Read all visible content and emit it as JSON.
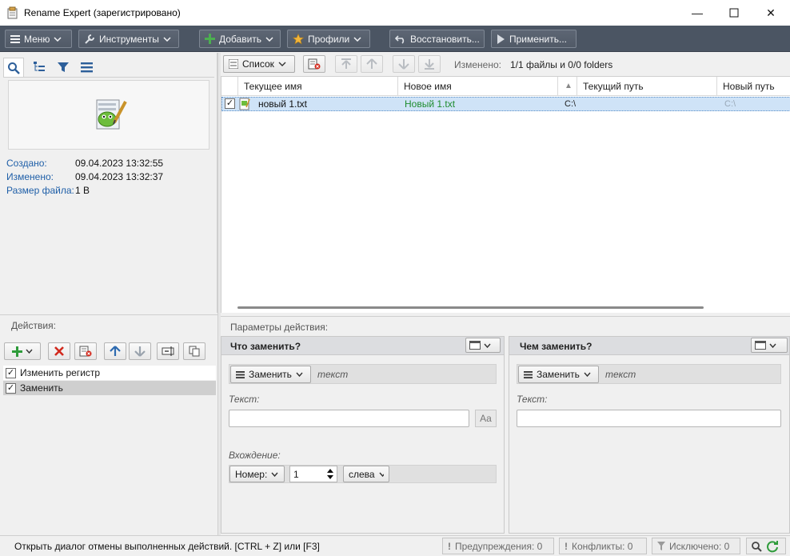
{
  "window": {
    "title": "Rename Expert (зарегистрировано)",
    "min_glyph": "—",
    "max_glyph": "☐",
    "close_glyph": "✕"
  },
  "toolbar": {
    "menu": "Меню",
    "tools": "Инструменты",
    "add": "Добавить",
    "profiles": "Профили",
    "restore": "Восстановить...",
    "apply": "Применить..."
  },
  "info": {
    "created_label": "Создано:",
    "created_value": "09.04.2023 13:32:55",
    "modified_label": "Изменено:",
    "modified_value": "09.04.2023 13:32:37",
    "size_label": "Размер файла:",
    "size_value": "1 B"
  },
  "grid_toolbar": {
    "view_label": "Список",
    "changed_label": "Изменено:",
    "changed_value": "1/1 файлы и 0/0 folders"
  },
  "grid": {
    "columns": [
      "Текущее имя",
      "Новое имя",
      "Текущий путь",
      "Новый путь"
    ],
    "rows": [
      {
        "checked": true,
        "current_name": "новый 1.txt",
        "new_name": "Новый 1.txt",
        "current_path": "C:\\",
        "new_path": "C:\\"
      }
    ]
  },
  "actions": {
    "header": "Действия:",
    "items": [
      {
        "label": "Изменить регистр",
        "checked": true
      },
      {
        "label": "Заменить",
        "checked": true
      }
    ]
  },
  "params": {
    "header": "Параметры действия:",
    "find": {
      "title": "Что заменить?",
      "mode": "Заменить",
      "mode_hint": "текст",
      "text_label": "Текст:",
      "text_value": "",
      "case_btn": "Aa",
      "occurrence_label": "Вхождение:",
      "number_label": "Номер:",
      "number_value": "1",
      "side_value": "слева"
    },
    "replace": {
      "title": "Чем заменить?",
      "mode": "Заменить",
      "mode_hint": "текст",
      "text_label": "Текст:",
      "text_value": ""
    }
  },
  "status": {
    "message": "Открыть диалог отмены выполненных действий. [CTRL + Z] или [F3]",
    "warnings": "Предупреждения: 0",
    "conflicts": "Конфликты: 0",
    "excluded": "Исключено: 0"
  },
  "colors": {
    "toolbar_bg": "#4b5563",
    "new_name_green": "#1e8c2e",
    "label_blue": "#1f5fa8",
    "row_selected": "#cfe3f7"
  }
}
